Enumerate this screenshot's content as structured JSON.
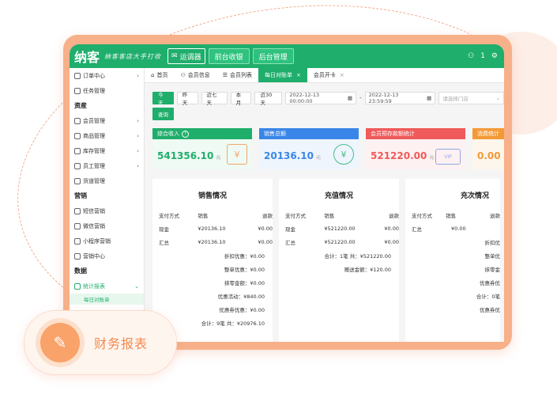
{
  "badge": {
    "label": "财务报表"
  },
  "topbar": {
    "logo": "纳客",
    "slogan": "纳客客店大手打收",
    "btn_label": "运调器",
    "tabs": [
      {
        "label": "前台收银"
      },
      {
        "label": "后台管理"
      }
    ],
    "user_count": "1"
  },
  "sidebar": {
    "items": [
      {
        "label": "订单中心"
      },
      {
        "label": "任务管理"
      },
      {
        "label": "资産",
        "head": true
      },
      {
        "label": "会员管理"
      },
      {
        "label": "商品管理"
      },
      {
        "label": "库存管理"
      },
      {
        "label": "员工管理"
      },
      {
        "label": "货道管理"
      },
      {
        "label": "营销",
        "head": true
      },
      {
        "label": "短信营销"
      },
      {
        "label": "微信营销"
      },
      {
        "label": "小程序营销"
      },
      {
        "label": "营销中心"
      },
      {
        "label": "数据",
        "head": true
      },
      {
        "label": "统计报表"
      }
    ],
    "sub_active": "每日对账单"
  },
  "tabs": [
    {
      "label": "首页"
    },
    {
      "label": "会员信息"
    },
    {
      "label": "会员列表"
    },
    {
      "label": "每日对账单"
    },
    {
      "label": "会员开卡"
    }
  ],
  "filter": {
    "ranges": [
      "今天",
      "昨天",
      "近七天",
      "本月",
      "近30天"
    ],
    "start": "2022-12-13 00:00:00",
    "sep": "-",
    "end": "2022-12-13 23:59:59",
    "store_placeholder": "请选择门店",
    "query": "查询"
  },
  "cards": [
    {
      "title": "综合收入",
      "value": "541356.10",
      "unit": "元",
      "color": "#1fae6b",
      "icon": "¥"
    },
    {
      "title": "销售总额",
      "value": "20136.10",
      "unit": "元",
      "color": "#3a86e8",
      "icon": "¥"
    },
    {
      "title": "会员预存款额统计",
      "value": "521220.00",
      "unit": "元",
      "color": "#ef5a5a",
      "icon": "VIP"
    },
    {
      "title": "消费统计",
      "value": "0.00",
      "unit": "",
      "color": "#f39a37",
      "icon": ""
    }
  ],
  "panels": {
    "sales": {
      "title": "销售情况",
      "headers": [
        "支付方式",
        "销售",
        "退款"
      ],
      "rows": [
        [
          "现金",
          "¥20136.10",
          "¥0.00"
        ],
        [
          "汇总",
          "¥20136.10",
          "¥0.00"
        ]
      ],
      "lines": [
        "折扣优惠：¥0.00",
        "整单优惠：¥0.00",
        "抹零金额：¥0.00",
        "优惠活动：¥840.00",
        "优惠券优惠：¥0.00",
        "合计：9笔 共：¥20976.10"
      ]
    },
    "recharge": {
      "title": "充值情况",
      "headers": [
        "支付方式",
        "销售",
        "退款"
      ],
      "rows": [
        [
          "现金",
          "¥521220.00",
          "¥0.00"
        ],
        [
          "汇总",
          "¥521220.00",
          "¥0.00"
        ]
      ],
      "lines": [
        "合计：1笔 共：¥521220.00",
        "赠送金额：¥120.00"
      ]
    },
    "times": {
      "title": "充次情况",
      "headers": [
        "支付方式",
        "销售",
        "退款"
      ],
      "rows": [
        [
          "汇总",
          "¥0.00",
          ""
        ]
      ],
      "lines": [
        "折扣优",
        "整单优",
        "抹零金",
        "优惠券优",
        "合计：0笔",
        "优惠券优"
      ]
    }
  }
}
